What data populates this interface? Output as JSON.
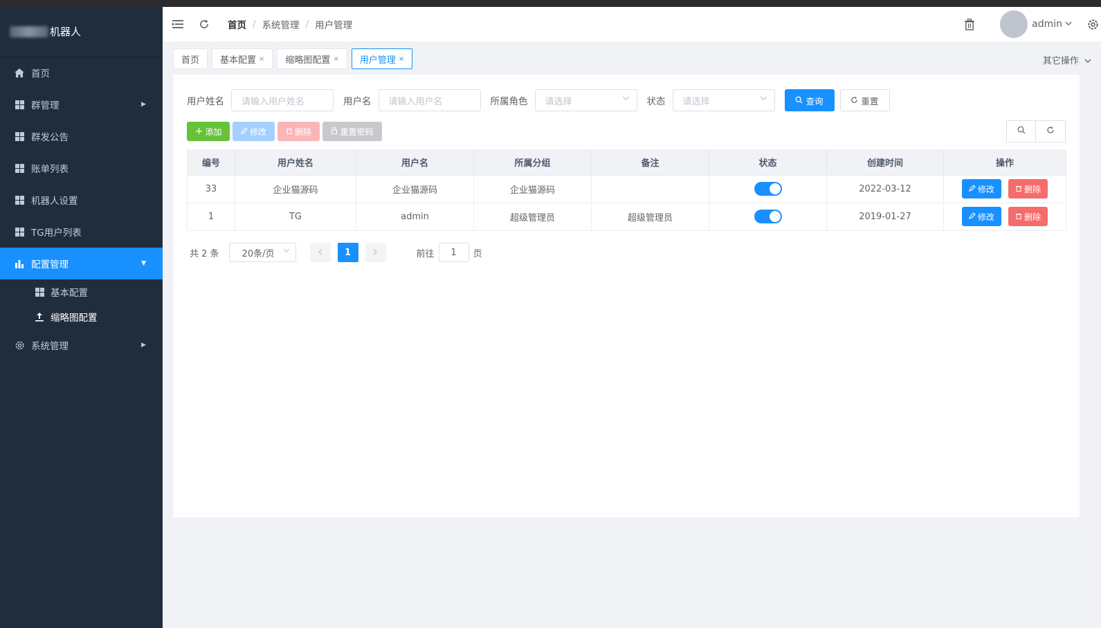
{
  "sidebar": {
    "logo_text": "机器人",
    "items": [
      {
        "label": "首页"
      },
      {
        "label": "群管理"
      },
      {
        "label": "群发公告"
      },
      {
        "label": "账单列表"
      },
      {
        "label": "机器人设置"
      },
      {
        "label": "TG用户列表"
      },
      {
        "label": "配置管理"
      },
      {
        "label": "系统管理"
      }
    ],
    "sub_items": [
      {
        "label": "基本配置"
      },
      {
        "label": "缩略图配置"
      }
    ],
    "active_color": "#1890ff",
    "bg_color": "#1f2d3d"
  },
  "navbar": {
    "breadcrumb": [
      "首页",
      "系统管理",
      "用户管理"
    ],
    "username": "admin"
  },
  "tags": {
    "items": [
      {
        "label": "首页"
      },
      {
        "label": "基本配置"
      },
      {
        "label": "缩略图配置"
      },
      {
        "label": "用户管理"
      }
    ],
    "close_glyph": "×",
    "other_ops": "其它操作"
  },
  "search": {
    "name_label": "用户姓名",
    "name_placeholder": "请输入用户姓名",
    "username_label": "用户名",
    "username_placeholder": "请输入用户名",
    "role_label": "所属角色",
    "role_placeholder": "请选择",
    "status_label": "状态",
    "status_placeholder": "请选择",
    "query_label": "查询",
    "reset_label": "重置"
  },
  "toolbar": {
    "add_label": "添加",
    "edit_label": "修改",
    "delete_label": "删除",
    "reset_pwd_label": "重置密码"
  },
  "table": {
    "headers": [
      "编号",
      "用户姓名",
      "用户名",
      "所属分组",
      "备注",
      "状态",
      "创建时间",
      "操作"
    ],
    "rows": [
      {
        "id": "33",
        "name": "企业猫源码",
        "username": "企业猫源码",
        "group": "企业猫源码",
        "remark": "",
        "status": true,
        "created": "2022-03-12"
      },
      {
        "id": "1",
        "name": "TG",
        "username": "admin",
        "group": "超级管理员",
        "remark": "超级管理员",
        "status": true,
        "created": "2019-01-27"
      }
    ],
    "edit_label": "修改",
    "delete_label": "删除"
  },
  "pagination": {
    "total_text": "共 2 条",
    "page_size": "20条/页",
    "current_page": "1",
    "goto_label": "前往",
    "goto_value": "1",
    "page_suffix": "页"
  }
}
